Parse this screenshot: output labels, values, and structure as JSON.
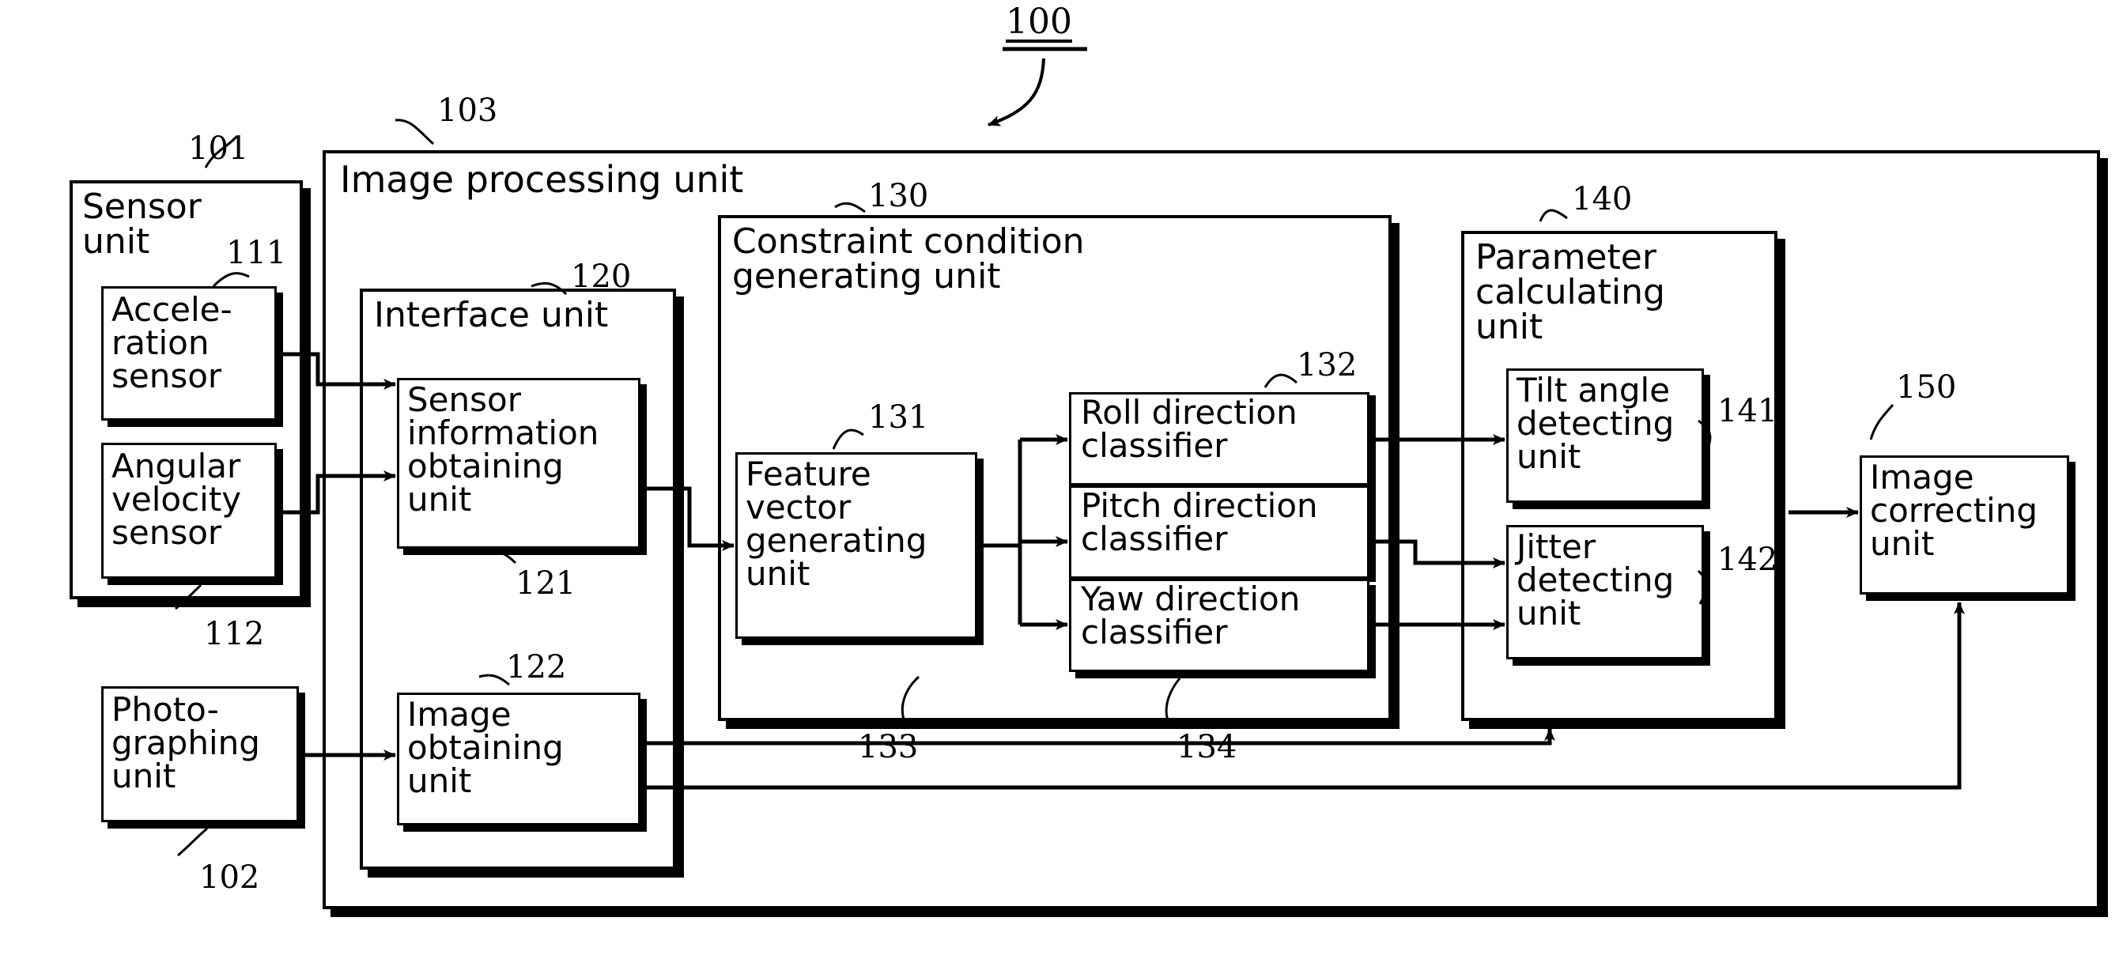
{
  "figure": {
    "root_numeral": "100",
    "title": "Image processing apparatus block diagram"
  },
  "blocks": {
    "sensor_unit": {
      "label": "Sensor\nunit",
      "numeral": "101"
    },
    "acceleration_sensor": {
      "label": "Accele-\nration\nsensor",
      "numeral": "111"
    },
    "angular_velocity_sensor": {
      "label": "Angular\nvelocity\nsensor",
      "numeral": "112"
    },
    "photographing_unit": {
      "label": "Photo-\ngraphing\nunit",
      "numeral": "102"
    },
    "image_processing_unit": {
      "label": "Image processing unit",
      "numeral": "103"
    },
    "interface_unit": {
      "label": "Interface unit",
      "numeral": "120"
    },
    "sensor_information_obtaining_unit": {
      "label": "Sensor\ninformation\nobtaining\nunit",
      "numeral": "121"
    },
    "image_obtaining_unit": {
      "label": "Image\nobtaining\nunit",
      "numeral": "122"
    },
    "constraint_condition_generating_unit": {
      "label": "Constraint condition\ngenerating unit",
      "numeral": "130"
    },
    "feature_vector_generating_unit": {
      "label": "Feature\nvector\ngenerating\nunit",
      "numeral": "131"
    },
    "roll_direction_classifier": {
      "label": "Roll direction\nclassifier",
      "numeral": "132"
    },
    "pitch_direction_classifier": {
      "label": "Pitch direction\nclassifier",
      "numeral": "133"
    },
    "yaw_direction_classifier": {
      "label": "Yaw direction\nclassifier",
      "numeral": "134"
    },
    "parameter_calculating_unit": {
      "label": "Parameter\ncalculating\nunit",
      "numeral": "140"
    },
    "tilt_angle_detecting_unit": {
      "label": "Tilt angle\ndetecting\nunit",
      "numeral": "141"
    },
    "jitter_detecting_unit": {
      "label": "Jitter\ndetecting\nunit",
      "numeral": "142"
    },
    "image_correcting_unit": {
      "label": "Image\ncorrecting\nunit",
      "numeral": "150"
    }
  },
  "colors": {
    "stroke": "#000000",
    "background": "#ffffff"
  }
}
